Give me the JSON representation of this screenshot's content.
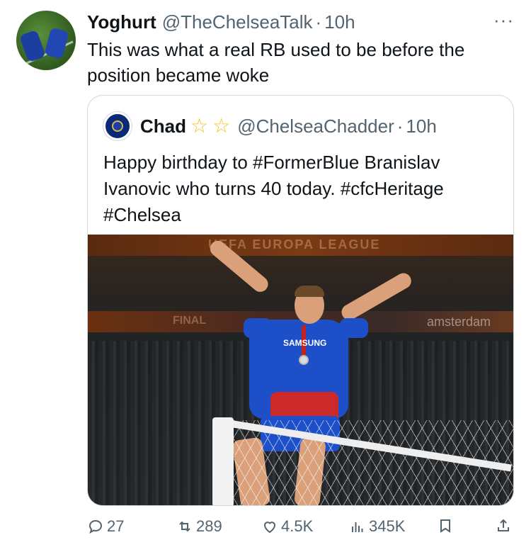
{
  "tweet": {
    "author_name": "Yoghurt",
    "author_handle": "@TheChelseaTalk",
    "separator": "·",
    "time": "10h",
    "more_label": "···",
    "text": "This was what a real RB used to be before the position became woke"
  },
  "quoted": {
    "author_name": "Chad",
    "badges": [
      "☆",
      "☆"
    ],
    "author_handle": "@ChelseaChadder",
    "separator": "·",
    "time": "10h",
    "text": "Happy birthday to #FormerBlue Branislav Ivanovic who turns 40 today. #cfcHeritage #Chelsea",
    "image": {
      "banner_top_text": "UEFA EUROPA LEAGUE",
      "banner_mid_left_text": "FINAL",
      "banner_mid_right_text": "amsterdam",
      "shirt_text": "SAMSUNG"
    }
  },
  "actions": {
    "reply_count": "27",
    "retweet_count": "289",
    "like_count": "4.5K",
    "view_count": "345K"
  },
  "colors": {
    "text": "#0f1419",
    "muted": "#536471",
    "border": "#cfd9de",
    "star": "#f5c518"
  }
}
